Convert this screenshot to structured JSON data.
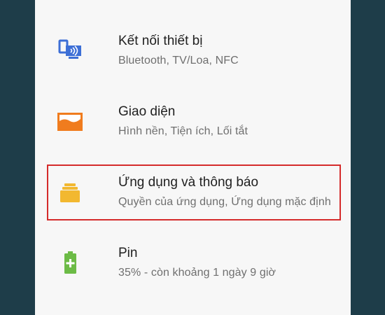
{
  "settings": {
    "items": [
      {
        "icon": "connected-devices-icon",
        "title": "Kết nối thiết bị",
        "summary": "Bluetooth, TV/Loa, NFC",
        "color": "#3d6fd6"
      },
      {
        "icon": "display-icon",
        "title": "Giao diện",
        "summary": "Hình nền, Tiện ích, Lối tắt",
        "color": "#f07c1e"
      },
      {
        "icon": "apps-icon",
        "title": "Ứng dụng và thông báo",
        "summary": "Quyền của ứng dụng, Ứng dụng mặc định",
        "color": "#f2b830"
      },
      {
        "icon": "battery-icon",
        "title": "Pin",
        "summary": "35% - còn khoảng 1 ngày 9 giờ",
        "color": "#6cbb46"
      }
    ],
    "highlight_color": "#d52b2b"
  }
}
